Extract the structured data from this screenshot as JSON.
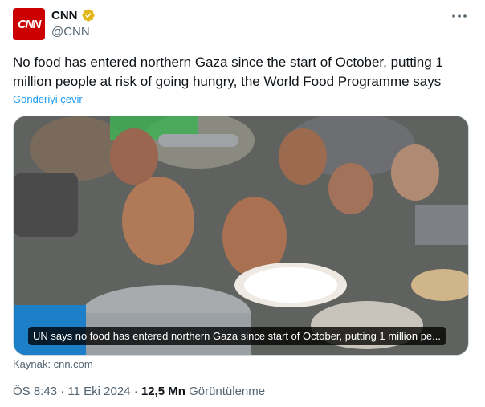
{
  "author": {
    "avatar_text": "CNN",
    "display_name": "CNN",
    "handle": "@CNN",
    "verified_color": "#e2b719",
    "avatar_color": "#cc0000"
  },
  "tweet": {
    "text": "No food has entered northern Gaza since the start of October, putting 1 million people at risk of going hungry, the World Food Programme says",
    "translate_label": "Gönderiyi çevir"
  },
  "media": {
    "caption": "UN says no food has entered northern Gaza since start of October, putting 1 million pe..."
  },
  "source": "Kaynak: cnn.com",
  "meta": {
    "time": "ÖS 8:43",
    "separator": "·",
    "date": "11 Eki 2024",
    "views_count": "12,5 Mn",
    "views_label": "Görüntülenme"
  },
  "icons": {
    "more": "more-icon",
    "verified": "verified-badge-icon"
  },
  "colors": {
    "link": "#1d9bf0",
    "secondary_text": "#536471",
    "primary_text": "#0f1419"
  }
}
